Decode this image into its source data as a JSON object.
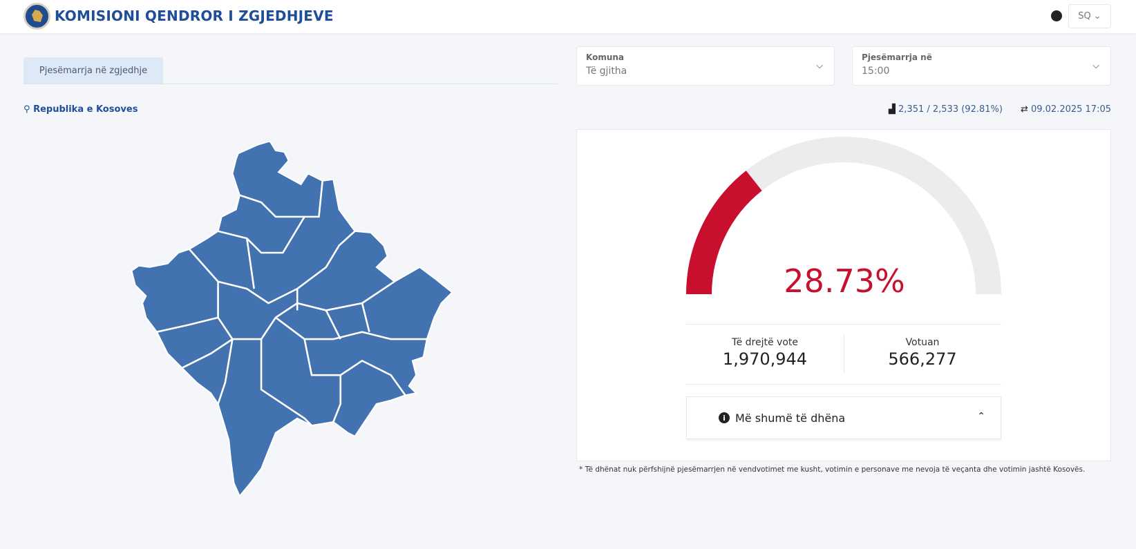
{
  "header": {
    "title": "KOMISIONI QENDROR I ZGJEDHJEVE",
    "language": "SQ"
  },
  "tabs": [
    {
      "label": "Pjesëmarrja në zgjedhje",
      "active": true
    }
  ],
  "filters": {
    "komuna": {
      "label": "Komuna",
      "value": "Të gjitha"
    },
    "time": {
      "label": "Pjesëmarrja në",
      "value": "15:00"
    }
  },
  "location": "Republika e Kosoves",
  "stats": {
    "stations": "2,351 / 2,533 (92.81%)",
    "updated": "09.02.2025 17:05"
  },
  "turnout": {
    "percent_label": "28.73%",
    "percent": 28.73,
    "eligible_label": "Të drejtë vote",
    "eligible": "1,970,944",
    "voted_label": "Votuan",
    "voted": "566,277"
  },
  "more_label": "Më shumë të dhëna",
  "footnote": "* Të dhënat nuk përfshijnë pjesëmarrjen në vendvotimet me kusht, votimin e personave me nevoja të veçanta dhe votimin jashtë Kosovës.",
  "colors": {
    "brand": "#1f4e99",
    "gauge": "#c8102e",
    "map": "#4372b0"
  }
}
